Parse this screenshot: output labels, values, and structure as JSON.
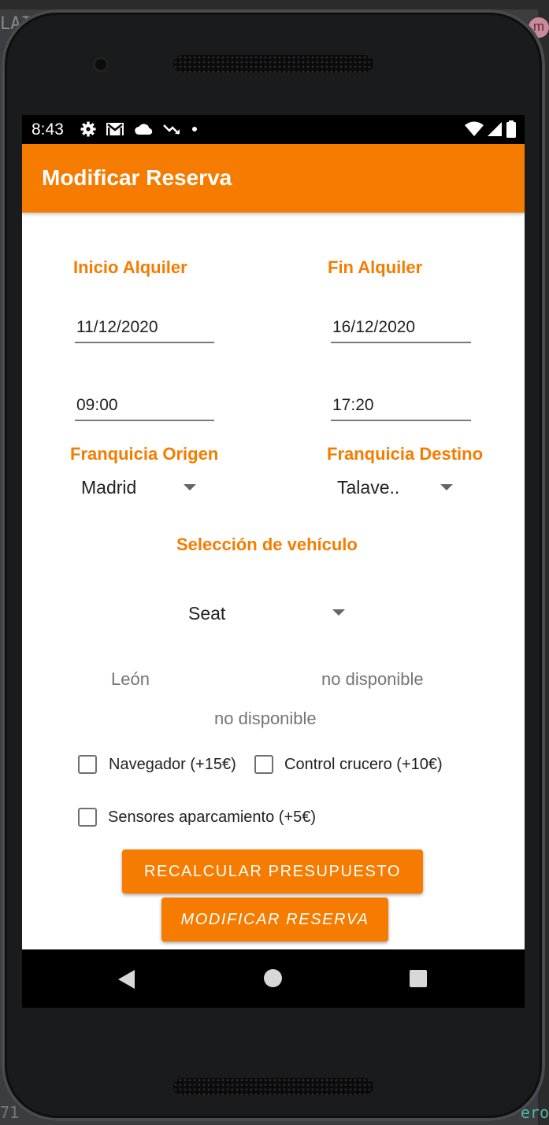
{
  "status_bar": {
    "time": "8:43",
    "icons": [
      "gear-icon",
      "gmail-icon",
      "cloud-icon",
      "trending-down-icon",
      "dot-icon",
      "wifi-icon",
      "signal-icon",
      "battery-icon"
    ]
  },
  "app_bar": {
    "title": "Modificar Reserva"
  },
  "form": {
    "inicio_label": "Inicio Alquiler",
    "fin_label": "Fin Alquiler",
    "inicio_fecha": "11/12/2020",
    "fin_fecha": "16/12/2020",
    "inicio_hora": "09:00",
    "fin_hora": "17:20",
    "origen_label": "Franquicia Origen",
    "destino_label": "Franquicia Destino",
    "origen_value": "Madrid",
    "destino_value": "Talave..",
    "vehiculo_label": "Selección de vehículo",
    "marca_value": "Seat",
    "modelo_text": "León",
    "disponibilidad_1": "no disponible",
    "disponibilidad_2": "no disponible",
    "extras": {
      "navegador": "Navegador (+15€)",
      "crucero": "Control crucero (+10€)",
      "sensores": "Sensores aparcamiento (+5€)"
    }
  },
  "buttons": {
    "recalcular": "RECALCULAR PRESUPUESTO",
    "modificar": "MODIFICAR RESERVA"
  },
  "colors": {
    "accent": "#f57c00",
    "statusbar": "#000000",
    "navbar": "#000000"
  },
  "background": {
    "ide_left_text": "LAI",
    "ide_avatar": "m",
    "ide_bottom_left": "71",
    "ide_bottom_right": "ero"
  }
}
